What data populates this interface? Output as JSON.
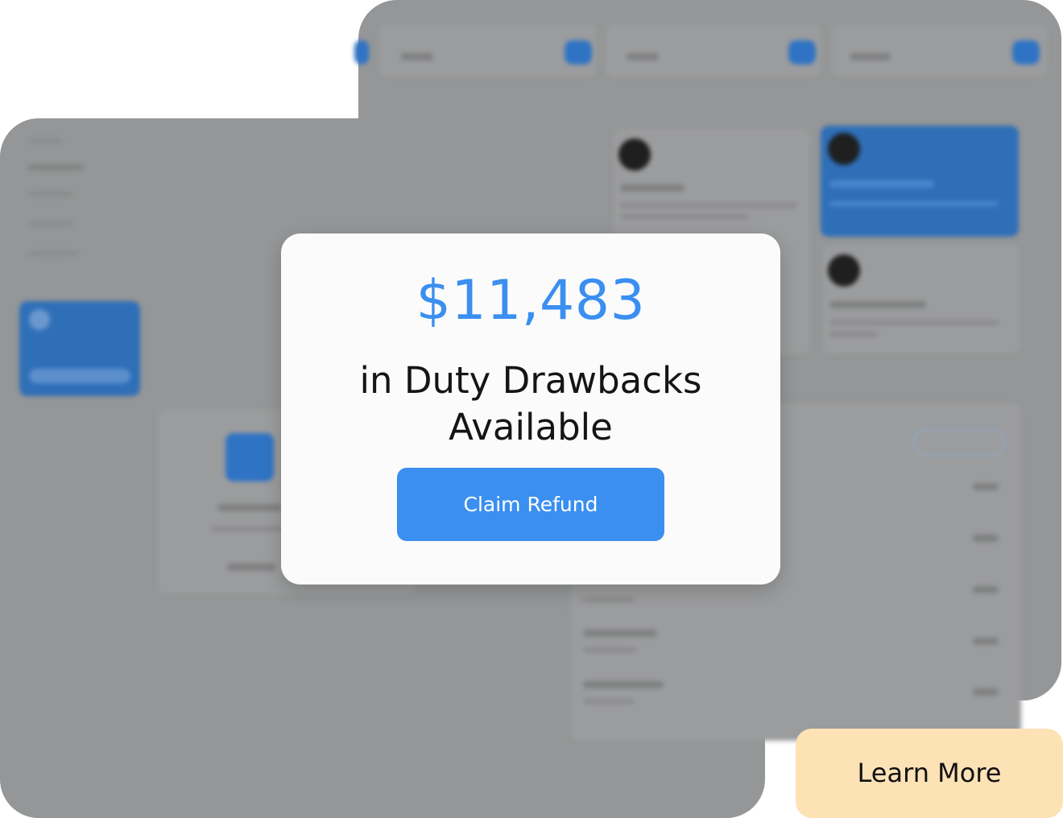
{
  "modal": {
    "amount": "$11,483",
    "line1": "in Duty Drawbacks",
    "line2": "Available",
    "cta_label": "Claim Refund"
  },
  "learn_more_label": "Learn More",
  "colors": {
    "accent": "#3a8ff0",
    "overlay": "#959697",
    "learn_more_bg": "#fde2b6",
    "modal_bg": "#fbfbfb"
  },
  "background_icons": [
    "plus-icon",
    "logo-icon",
    "document-icon"
  ]
}
